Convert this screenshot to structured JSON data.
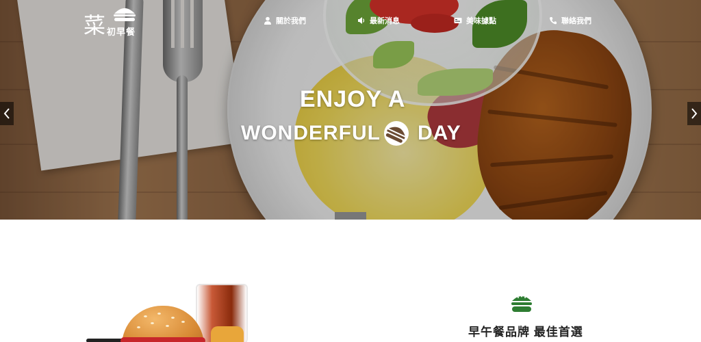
{
  "logo": {
    "main": "菜",
    "sub": "初早餐"
  },
  "nav": {
    "items": [
      {
        "label": "關於我們",
        "icon": "user-icon"
      },
      {
        "label": "最新消息",
        "icon": "megaphone-icon"
      },
      {
        "label": "美味據點",
        "icon": "id-card-icon"
      },
      {
        "label": "聯絡我們",
        "icon": "phone-icon"
      }
    ]
  },
  "hero": {
    "line1": "ENJOY A",
    "line2_left": "WONDERFUL",
    "line2_right": "DAY",
    "prev_icon": "chevron-left-icon",
    "next_icon": "chevron-right-icon",
    "scroll_icon": "chevron-down-icon"
  },
  "brand": {
    "icon": "burger-icon",
    "heading": "早午餐品牌 最佳首選"
  },
  "colors": {
    "brand_green": "#2e7d32",
    "hero_overlay": "#00000038",
    "scroll_tab": "#777777"
  }
}
